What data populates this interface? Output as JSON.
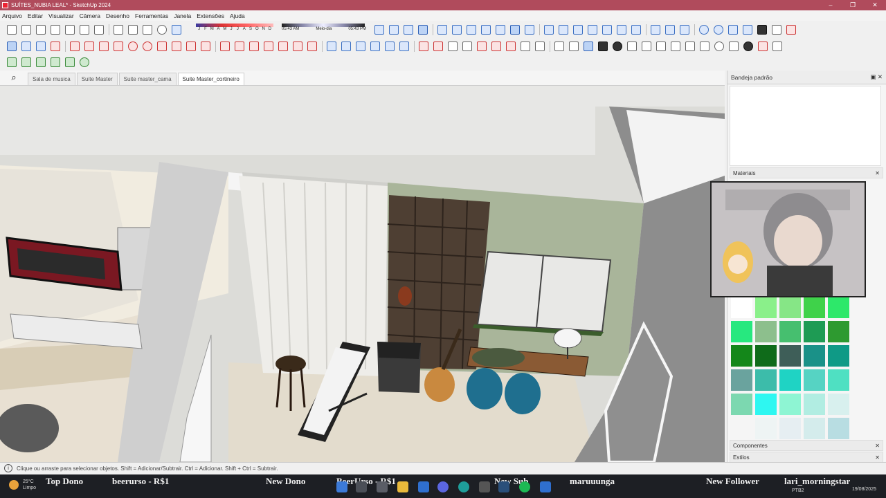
{
  "window": {
    "title": "SUÍTES_NUBIA LEAL* - SketchUp 2024",
    "controls": [
      "–",
      "❐",
      "✕"
    ]
  },
  "menu": [
    "Arquivo",
    "Editar",
    "Visualizar",
    "Câmera",
    "Desenho",
    "Ferramentas",
    "Janela",
    "Extensões",
    "Ajuda"
  ],
  "shadows": {
    "months": [
      "J",
      "F",
      "M",
      "A",
      "M",
      "J",
      "J",
      "A",
      "S",
      "O",
      "N",
      "D"
    ],
    "time_start": "05:43 AM",
    "time_mid": "Meio-dia",
    "time_end": "05:43 PM"
  },
  "scene_tabs": [
    {
      "label": "Sala de musica",
      "active": false
    },
    {
      "label": "Suite Master",
      "active": false
    },
    {
      "label": "Suite master_cama",
      "active": false
    },
    {
      "label": "Suite Master_cortineiro",
      "active": true
    }
  ],
  "tray": {
    "title": "Bandeja padrão",
    "sections": {
      "materiais": "Materiais",
      "componentes": "Componentes",
      "estilos": "Estilos"
    }
  },
  "swatch_colors": [
    "#ffffff",
    "#8af08a",
    "#86e686",
    "#3fd24a",
    "#2de86a",
    "#27e87f",
    "#8dbf8d",
    "#46bf6f",
    "#1e9b54",
    "#2e9a30",
    "#14871a",
    "#0f6b1a",
    "#3e5e58",
    "#1a9188",
    "#0f9a86",
    "#6aa39e",
    "#3cbcaa",
    "#1fd3c4",
    "#56d3c3",
    "#4fe0c2",
    "#7cd8b0",
    "#2ef7f1",
    "#8ef5d3",
    "#b1ede2",
    "#d8f0ee",
    "#f5f5f5",
    "#eef4f4",
    "#e6eef2",
    "#d4ecec",
    "#b8dde2"
  ],
  "status": {
    "message": "Clique ou arraste para selecionar objetos. Shift = Adicionar/Subtrair. Ctrl = Adicionar. Shift + Ctrl = Subtrair."
  },
  "stream_ticker": [
    {
      "label": "Top Dono",
      "value": "beerurso - R$1"
    },
    {
      "label": "New Dono",
      "value": "BeerUrso - R$1"
    },
    {
      "label": "New Sub",
      "value": "maruuunga"
    },
    {
      "label": "New Follower",
      "value": "lari_morningstar"
    }
  ],
  "taskbar": {
    "temp": "25°C",
    "weather": "Limpo",
    "lang": "PTB2",
    "date": "19/08/2025"
  }
}
